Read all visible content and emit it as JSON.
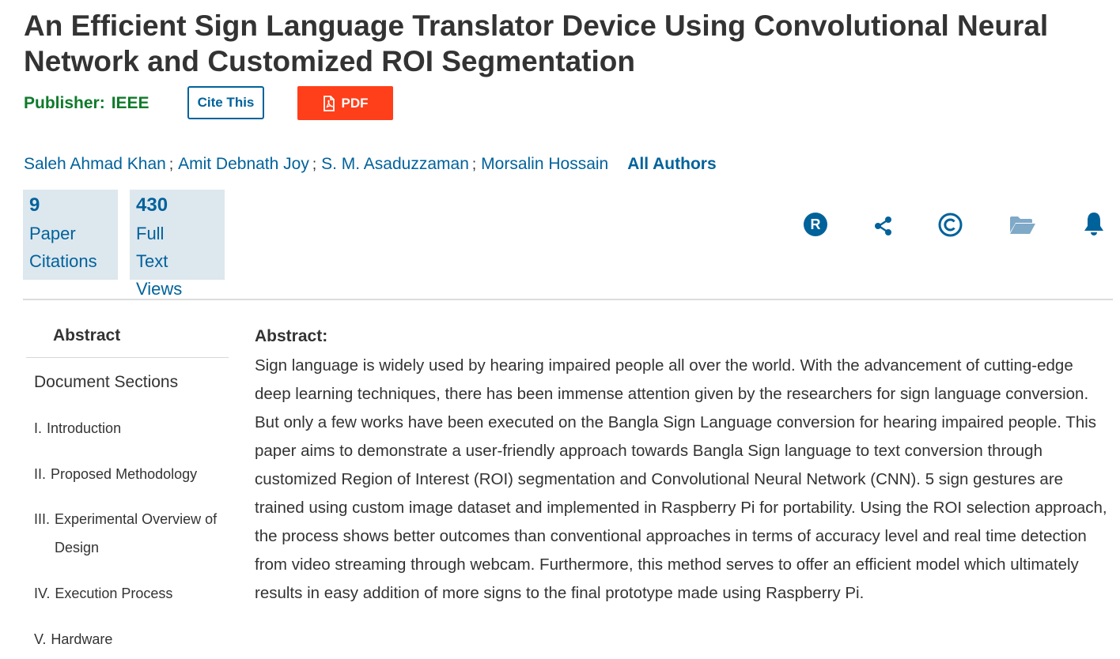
{
  "article": {
    "title": "An Efficient Sign Language Translator Device Using Convolutional Neural Network and Customized ROI Segmentation",
    "publisher_label": "Publisher:",
    "publisher_name": "IEEE"
  },
  "actions": {
    "cite_label": "Cite This",
    "pdf_label": "PDF"
  },
  "authors": {
    "list": [
      "Saleh Ahmad Khan",
      "Amit Debnath Joy",
      "S. M. Asaduzzaman",
      "Morsalin Hossain"
    ],
    "separator": ";",
    "all_authors_label": "All Authors"
  },
  "metrics": {
    "citations": {
      "count": "9",
      "line1": "Paper",
      "line2": "Citations"
    },
    "views": {
      "count": "430",
      "line1": "Full",
      "line2": "Text Views"
    }
  },
  "toolbar_icons": [
    "rights-icon",
    "share-icon",
    "copyright-icon",
    "folder-icon",
    "bell-icon"
  ],
  "sidebar": {
    "abstract_label": "Abstract",
    "sections_label": "Document Sections",
    "items": [
      {
        "num": "I.",
        "label": "Introduction"
      },
      {
        "num": "II.",
        "label": "Proposed Methodology"
      },
      {
        "num": "III.",
        "label": "Experimental Overview of Design"
      },
      {
        "num": "IV.",
        "label": "Execution Process"
      },
      {
        "num": "V.",
        "label": "Hardware"
      }
    ]
  },
  "abstract": {
    "heading": "Abstract:",
    "text": "Sign language is widely used by hearing impaired people all over the world. With the advancement of cutting-edge deep learning techniques, there has been immense attention given by the researchers for sign language conversion. But only a few works have been executed on the Bangla Sign Language conversion for hearing impaired people. This paper aims to demonstrate a user-friendly approach towards Bangla Sign language to text conversion through customized Region of Interest (ROI) segmentation and Convolutional Neural Network (CNN). 5 sign gestures are trained using custom image dataset and implemented in Raspberry Pi for portability. Using the ROI selection approach, the process shows better outcomes than conventional approaches in terms of accuracy level and real time detection from video streaming through webcam. Furthermore, this method serves to offer an efficient model which ultimately results in easy addition of more signs to the final prototype made using Raspberry Pi."
  },
  "colors": {
    "link": "#00629b",
    "publisher": "#0f7a2a",
    "pdf_button": "#ff3f1a",
    "metric_bg": "#dde7ee",
    "text": "#333333"
  }
}
